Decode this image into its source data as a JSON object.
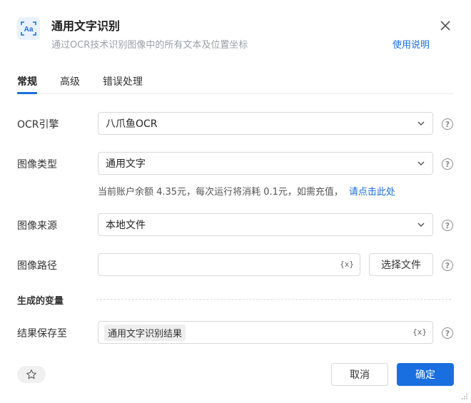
{
  "header": {
    "icon_text": "Aα",
    "title": "通用文字识别",
    "subtitle": "通过OCR技术识别图像中的所有文本及位置坐标",
    "help_link": "使用说明"
  },
  "tabs": [
    {
      "label": "常规",
      "active": true
    },
    {
      "label": "高级",
      "active": false
    },
    {
      "label": "错误处理",
      "active": false
    }
  ],
  "form": {
    "ocr_engine": {
      "label": "OCR引擎",
      "value": "八爪鱼OCR"
    },
    "image_type": {
      "label": "图像类型",
      "value": "通用文字"
    },
    "balance_note": "当前账户余额 4.35元，每次运行将消耗 0.1元，如需充值，",
    "recharge_link": "请点击此处",
    "image_source": {
      "label": "图像来源",
      "value": "本地文件"
    },
    "image_path": {
      "label": "图像路径",
      "value": "",
      "var_icon": "{x}"
    },
    "choose_file": "选择文件",
    "generated_vars_title": "生成的变量",
    "save_to": {
      "label": "结果保存至",
      "chip": "通用文字识别结果",
      "var_icon": "{x}"
    }
  },
  "footer": {
    "cancel": "取消",
    "confirm": "确定"
  },
  "colors": {
    "accent": "#1a6fe0",
    "border": "#d9d9d9"
  }
}
